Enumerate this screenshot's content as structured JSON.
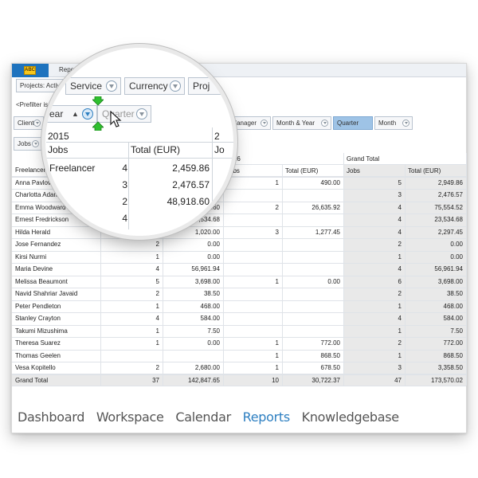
{
  "app": {
    "logo_text": "ABC",
    "reports_tab": "Report"
  },
  "filters_top": [
    {
      "label": "Projects: Active"
    },
    {
      "label": "Service"
    },
    {
      "label": "Currency"
    },
    {
      "label": "Proj"
    }
  ],
  "prefilter_label": "<Prefilter is P",
  "pivot_fields": {
    "client": "Client",
    "year": "Year",
    "quarter": "Quarter",
    "account_manager": "t Manager",
    "month_year": "Month & Year",
    "quarter_active": "Quarter",
    "month": "Month"
  },
  "data_field_label": "Jobs",
  "column_headers": {
    "year_2015": "2015",
    "year_2016": "2016",
    "grand_total": "Grand Total",
    "jobs": "Jobs",
    "total": "Total (EUR)"
  },
  "rows": [
    {
      "name": "Freelancer",
      "j2015": "4",
      "t2015": "2,459.86",
      "j2016": "",
      "t2016": "",
      "jgt": "",
      "tgt": ""
    },
    {
      "name": "Anna Pavlova",
      "j2015": "3",
      "t2015": "2,476.57",
      "j2016": "1",
      "t2016": "490.00",
      "jgt": "5",
      "tgt": "2,949.86"
    },
    {
      "name": "Charlotta Adams",
      "j2015": "",
      "t2015": "76.57",
      "j2016": "",
      "t2016": "",
      "jgt": "3",
      "tgt": "2,476.57"
    },
    {
      "name": "Emma Woodward",
      "j2015": "2",
      "t2015": "48,918.60",
      "j2016": "2",
      "t2016": "26,635.92",
      "jgt": "4",
      "tgt": "75,554.52"
    },
    {
      "name": "Ernest Fredrickson",
      "j2015": "4",
      "t2015": "23,534.68",
      "j2016": "",
      "t2016": "",
      "jgt": "4",
      "tgt": "23,534.68"
    },
    {
      "name": "Hilda Herald",
      "j2015": "1",
      "t2015": "1,020.00",
      "j2016": "3",
      "t2016": "1,277.45",
      "jgt": "4",
      "tgt": "2,297.45"
    },
    {
      "name": "Jose Fernandez",
      "j2015": "2",
      "t2015": "0.00",
      "j2016": "",
      "t2016": "",
      "jgt": "2",
      "tgt": "0.00"
    },
    {
      "name": "Kirsi Nurmi",
      "j2015": "1",
      "t2015": "0.00",
      "j2016": "",
      "t2016": "",
      "jgt": "1",
      "tgt": "0.00"
    },
    {
      "name": "Maria Devine",
      "j2015": "4",
      "t2015": "56,961.94",
      "j2016": "",
      "t2016": "",
      "jgt": "4",
      "tgt": "56,961.94"
    },
    {
      "name": "Melissa Beaumont",
      "j2015": "5",
      "t2015": "3,698.00",
      "j2016": "1",
      "t2016": "0.00",
      "jgt": "6",
      "tgt": "3,698.00"
    },
    {
      "name": "Navid Shahriar Javaid",
      "j2015": "2",
      "t2015": "38.50",
      "j2016": "",
      "t2016": "",
      "jgt": "2",
      "tgt": "38.50"
    },
    {
      "name": "Peter Pendleton",
      "j2015": "1",
      "t2015": "468.00",
      "j2016": "",
      "t2016": "",
      "jgt": "1",
      "tgt": "468.00"
    },
    {
      "name": "Stanley Crayton",
      "j2015": "4",
      "t2015": "584.00",
      "j2016": "",
      "t2016": "",
      "jgt": "4",
      "tgt": "584.00"
    },
    {
      "name": "Takumi Mizushima",
      "j2015": "1",
      "t2015": "7.50",
      "j2016": "",
      "t2016": "",
      "jgt": "1",
      "tgt": "7.50"
    },
    {
      "name": "Theresa Suarez",
      "j2015": "1",
      "t2015": "0.00",
      "j2016": "1",
      "t2016": "772.00",
      "jgt": "2",
      "tgt": "772.00"
    },
    {
      "name": "Thomas Geelen",
      "j2015": "",
      "t2015": "",
      "j2016": "1",
      "t2016": "868.50",
      "jgt": "1",
      "tgt": "868.50"
    },
    {
      "name": "Vesa Kopitello",
      "j2015": "2",
      "t2015": "2,680.00",
      "j2016": "1",
      "t2016": "678.50",
      "jgt": "3",
      "tgt": "3,358.50"
    },
    {
      "name": "Grand Total",
      "j2015": "37",
      "t2015": "142,847.65",
      "j2016": "10",
      "t2016": "30,722.37",
      "jgt": "47",
      "tgt": "173,570.02"
    }
  ],
  "magnifier": {
    "year_label": "ear",
    "quarter_label": "Quarter",
    "year_2015": "2015",
    "year_next_partial": "2",
    "jobs_label": "Jobs",
    "total_label": "Total (EUR)",
    "jobs_partial": "Jo",
    "freelancer_label": "Freelancer",
    "values": [
      {
        "jobs": "4",
        "total": "2,459.86"
      },
      {
        "jobs": "3",
        "total": "2,476.57"
      },
      {
        "jobs": "2",
        "total": "48,918.60"
      },
      {
        "jobs": "4",
        "total": ""
      }
    ],
    "row_labels": [
      "Anna Pavlova",
      "Charlotta Adams",
      "Emma Woodward",
      "Ernest Fredrickson"
    ],
    "row_total_clip": [
      "2,476.57",
      "76.57",
      "48,918.60",
      "23,534.68"
    ]
  },
  "bottom_nav": [
    {
      "label": "Dashboard",
      "active": false
    },
    {
      "label": "Workspace",
      "active": false
    },
    {
      "label": "Calendar",
      "active": false
    },
    {
      "label": "Reports",
      "active": true
    },
    {
      "label": "Knowledgebase",
      "active": false
    }
  ],
  "colors": {
    "accent": "#2d7fc1",
    "app_tab": "#1e73be",
    "active_field": "#9ec3e6",
    "grand_total_band": "#e9e9e9"
  }
}
